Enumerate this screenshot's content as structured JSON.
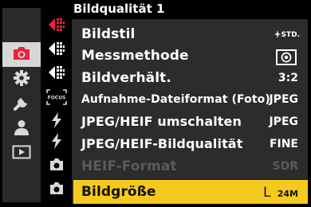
{
  "menu": {
    "title": "Bildqualität 1",
    "items": [
      {
        "label": "Bildstil",
        "value": "STD.",
        "value_icon": "sparkle-std-icon"
      },
      {
        "label": "Messmethode",
        "value": "",
        "value_icon": "metering-icon"
      },
      {
        "label": "Bildverhält.",
        "value": "3:2"
      },
      {
        "label": "Aufnahme-Dateiformat (Foto)",
        "value": "JPEG"
      },
      {
        "label": "JPEG/HEIF umschalten",
        "value": "JPEG"
      },
      {
        "label": "JPEG/HEIF-Bildqualität",
        "value": "FINE"
      },
      {
        "label": "HEIF-Format",
        "value": "SDR",
        "state": "disabled"
      },
      {
        "label": "Bildgröße",
        "value_main": "L",
        "value_sub": "24M",
        "state": "selected"
      }
    ]
  },
  "sidebar": {
    "main_tabs": [
      {
        "icon": "camera-icon",
        "active": true
      },
      {
        "icon": "gear-icon"
      },
      {
        "icon": "wrench-icon"
      },
      {
        "icon": "person-icon"
      },
      {
        "icon": "playback-icon"
      }
    ],
    "sub_tabs": [
      {
        "icon": "arrow-left-icon",
        "color": "#e8233a"
      },
      {
        "icon": "arrow-left-icon",
        "color": "#ffffff"
      },
      {
        "icon": "arrow-left-icon",
        "color": "#ffffff"
      },
      {
        "icon": "focus-icon",
        "label": "FOCUS"
      },
      {
        "icon": "flash-icon"
      },
      {
        "icon": "flash-icon"
      },
      {
        "icon": "camera-small-icon"
      },
      {
        "icon": "camera-small-icon"
      }
    ]
  },
  "colors": {
    "accent_red": "#e8233a",
    "selected_bg": "#f6c91d",
    "panel_bg": "#2c2c2c",
    "disabled_text": "#5a5a5a"
  }
}
